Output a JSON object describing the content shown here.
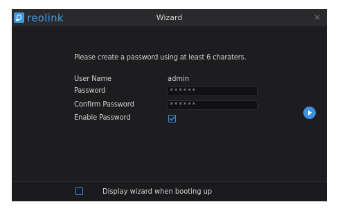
{
  "brand": {
    "logo_text": "reolink",
    "logo_icon": "reolink-logo-icon",
    "accent": "#3d8fe0"
  },
  "window": {
    "title": "Wizard",
    "close_glyph": "×"
  },
  "form": {
    "instruction": "Please create a password using at least 6 charaters.",
    "username": {
      "label": "User Name",
      "value": "admin"
    },
    "password": {
      "label": "Password",
      "value": "******"
    },
    "confirm_password": {
      "label": "Confirm Password",
      "value": "******"
    },
    "enable_password": {
      "label": "Enable Password",
      "checked": true
    }
  },
  "nav": {
    "next_icon": "play-arrow-icon"
  },
  "footer": {
    "label": "Display wizard when booting up",
    "checked": false
  }
}
